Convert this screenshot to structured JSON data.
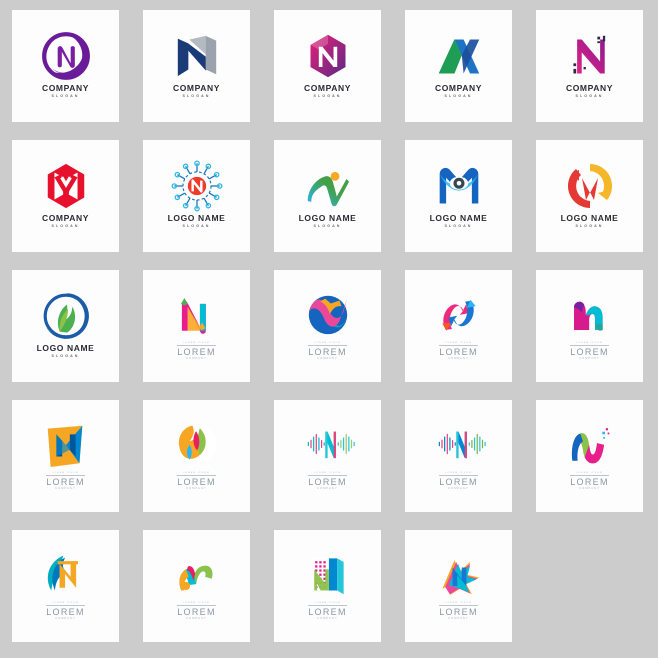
{
  "page": {
    "background_color": "#cccccc",
    "card_color": "#fdfdfd",
    "columns": 5,
    "rows": 5,
    "total_logos": 23
  },
  "label_styles": {
    "company": {
      "title": "COMPANY",
      "slogan": "SLOGAN"
    },
    "logoname": {
      "title": "LOGO NAME",
      "slogan": "SLOGAN"
    },
    "lorem": {
      "pre": "LOREM IPSUM",
      "title": "LOREM",
      "sub": "COMPANY"
    }
  },
  "logos": [
    {
      "id": "n-circle-brush-purple",
      "style": "company",
      "title": "COMPANY",
      "slogan": "SLOGAN",
      "colors": [
        "#6a1b9a",
        "#7b1fa2"
      ]
    },
    {
      "id": "n-ribbon-navy-silver",
      "style": "company",
      "title": "COMPANY",
      "slogan": "SLOGAN",
      "colors": [
        "#1b3a78",
        "#9aa3ad"
      ]
    },
    {
      "id": "n-hexagon-magenta-purple",
      "style": "company",
      "title": "COMPANY",
      "slogan": "SLOGAN",
      "colors": [
        "#e81f76",
        "#5b2a86"
      ]
    },
    {
      "id": "n-folded-ribbon-green-blue",
      "style": "company",
      "title": "COMPANY",
      "slogan": "SLOGAN",
      "colors": [
        "#1f9d55",
        "#1d74c4",
        "#1b4f9c"
      ]
    },
    {
      "id": "n-pixel-dots-magenta-purple",
      "style": "company",
      "title": "COMPANY",
      "slogan": "SLOGAN",
      "colors": [
        "#8e1a8c",
        "#e0238a",
        "#2b2b44"
      ]
    },
    {
      "id": "n-hexagon-red",
      "style": "company",
      "title": "COMPANY",
      "slogan": "SLOGAN",
      "colors": [
        "#e8112d",
        "#f44336"
      ]
    },
    {
      "id": "n-tech-network-nodes",
      "style": "logoname",
      "title": "LOGO NAME",
      "slogan": "SLOGAN",
      "colors": [
        "#1a77c2",
        "#2bb8e8",
        "#ef3b2c"
      ]
    },
    {
      "id": "n-swoosh-person-green-blue",
      "style": "logoname",
      "title": "LOGO NAME",
      "slogan": "SLOGAN",
      "colors": [
        "#29b6f6",
        "#43a047",
        "#f9a825"
      ]
    },
    {
      "id": "n-eye-blue",
      "style": "logoname",
      "title": "LOGO NAME",
      "slogan": "SLOGAN",
      "colors": [
        "#1565c0",
        "#29b6f6",
        "#37474f"
      ]
    },
    {
      "id": "n-arrow-circle-red-yellow",
      "style": "logoname",
      "title": "LOGO NAME",
      "slogan": "SLOGAN",
      "colors": [
        "#e53935",
        "#f4b72a"
      ]
    },
    {
      "id": "n-leaf-circle-green-blue",
      "style": "logoname",
      "title": "LOGO NAME",
      "slogan": "SLOGAN",
      "colors": [
        "#1c5ba8",
        "#4caf50",
        "#8bc34a"
      ]
    },
    {
      "id": "n-ribbon-pink-teal",
      "style": "lorem",
      "title": "LOREM",
      "sub": "COMPANY",
      "colors": [
        "#e91e8c",
        "#f9a825",
        "#00bcd4",
        "#4caf50"
      ]
    },
    {
      "id": "n-wave-circle-pink-blue",
      "style": "lorem",
      "title": "LOREM",
      "sub": "COMPANY",
      "colors": [
        "#ec4899",
        "#f6a623",
        "#0ea5b7",
        "#1565c0"
      ]
    },
    {
      "id": "n-arrow-swoosh-pink-blue",
      "style": "lorem",
      "title": "LOREM",
      "sub": "COMPANY",
      "colors": [
        "#ee2a7b",
        "#f05a28",
        "#29b6f6",
        "#1976d2"
      ]
    },
    {
      "id": "n-twin-blob-magenta-teal",
      "style": "lorem",
      "title": "LOREM",
      "sub": "COMPANY",
      "colors": [
        "#d81b8c",
        "#7b1fa2",
        "#00bcd4",
        "#26a69a"
      ]
    },
    {
      "id": "n-origami-orange-blue",
      "style": "lorem",
      "title": "LOREM",
      "sub": "COMPANY",
      "colors": [
        "#f5a623",
        "#0288d1",
        "#01579b"
      ]
    },
    {
      "id": "n-sphere-leaf-multicolor",
      "style": "lorem",
      "title": "LOREM",
      "sub": "COMPANY",
      "colors": [
        "#f5a623",
        "#e91e63",
        "#8bc34a",
        "#29b6f6"
      ]
    },
    {
      "id": "n-soundwave-teal",
      "style": "lorem",
      "title": "LOREM",
      "sub": "COMPANY",
      "colors": [
        "#00bcd4",
        "#26c6da",
        "#ec407a",
        "#9ccc65"
      ]
    },
    {
      "id": "n-soundwave-blue",
      "style": "lorem",
      "title": "LOREM",
      "sub": "COMPANY",
      "colors": [
        "#0288d1",
        "#26c6da",
        "#ec407a",
        "#7cb342"
      ]
    },
    {
      "id": "n-brush-pixel-green-magenta",
      "style": "lorem",
      "title": "LOREM",
      "sub": "COMPANY",
      "colors": [
        "#8bc34a",
        "#1565c0",
        "#e91e8c",
        "#29b6f6"
      ]
    },
    {
      "id": "n-leaf-wing-orange-teal",
      "style": "lorem",
      "title": "LOREM",
      "sub": "COMPANY",
      "colors": [
        "#f5a623",
        "#00acc1",
        "#0277bd"
      ]
    },
    {
      "id": "n-script-rainbow",
      "style": "lorem",
      "title": "LOREM",
      "sub": "COMPANY",
      "colors": [
        "#f5a623",
        "#e91e63",
        "#00bcd4",
        "#8bc34a"
      ]
    },
    {
      "id": "n-building-dots-multicolor",
      "style": "lorem",
      "title": "LOREM",
      "sub": "COMPANY",
      "colors": [
        "#e91e8c",
        "#8bc34a",
        "#0288d1",
        "#26c6da"
      ]
    },
    {
      "id": "n-star-burst-multicolor",
      "style": "lorem",
      "title": "LOREM",
      "sub": "COMPANY",
      "colors": [
        "#ec4899",
        "#f5a623",
        "#00bcd4",
        "#1976d2"
      ]
    }
  ]
}
